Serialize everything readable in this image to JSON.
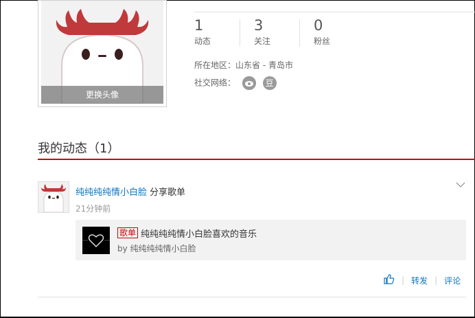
{
  "profile": {
    "change_avatar_label": "更换头像",
    "stats": [
      {
        "num": "1",
        "label": "动态"
      },
      {
        "num": "3",
        "label": "关注"
      },
      {
        "num": "0",
        "label": "粉丝"
      }
    ],
    "location_label": "所在地区：",
    "location_value": "山东省 - 青岛市",
    "social_label": "社交网络：",
    "social_icons": [
      "weibo-icon",
      "douban-icon"
    ],
    "douban_glyph": "豆"
  },
  "section": {
    "title": "我的动态（1）"
  },
  "feed": {
    "user_name": "纯纯纯纯情小白脸",
    "action": "分享歌单",
    "time": "21分钟前",
    "card": {
      "tag": "歌单",
      "title": "纯纯纯纯情小白脸喜欢的音乐",
      "by": "by 纯纯纯纯情小白脸"
    },
    "actions": {
      "repost": "转发",
      "comment": "评论"
    }
  },
  "colors": {
    "accent": "#c20c0c",
    "link": "#0c73c2",
    "moose_red": "#c0393b"
  }
}
